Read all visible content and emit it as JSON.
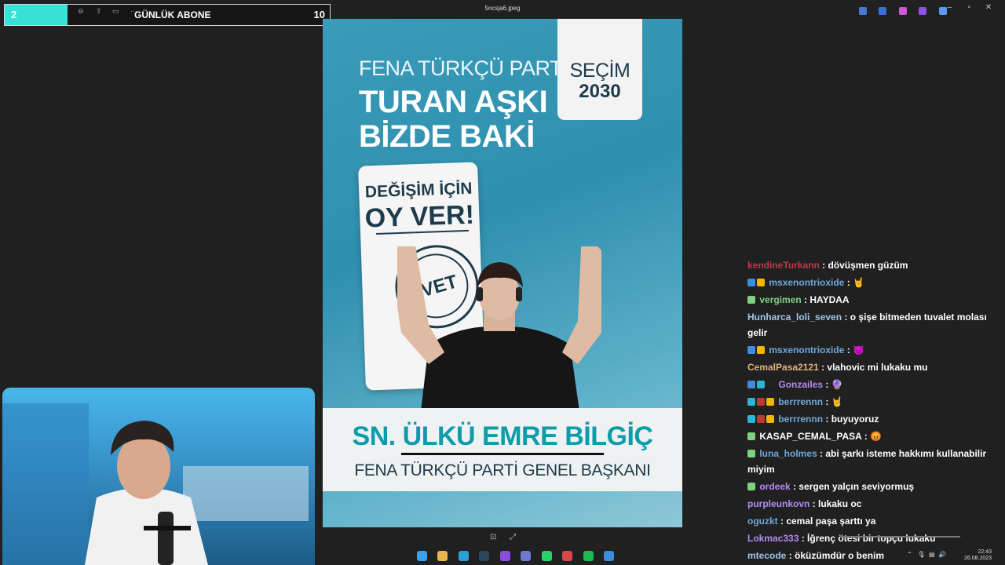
{
  "goal": {
    "current": "2",
    "label": "GÜNLÜK ABONE",
    "target": "10",
    "progress": 0.2
  },
  "viewer": {
    "filename": "5ncsja6.jpeg"
  },
  "window_controls": {
    "minimize": "–",
    "maximize": "▫",
    "close": "✕"
  },
  "poster": {
    "party_line": "FENA TÜRKÇÜ PARTİ",
    "slogan_1": "TURAN AŞKI",
    "slogan_2": "BİZDE BAKİ",
    "secim_word": "SEÇİM",
    "secim_year": "2030",
    "ballot_line1": "DEĞİŞİM İÇİN",
    "ballot_line2": "OY VER!",
    "stamp": "EVET",
    "name": "SN. ÜLKÜ EMRE BİLGİÇ",
    "title": "FENA TÜRKÇÜ PARTİ GENEL BAŞKANI"
  },
  "chat": {
    "messages": [
      {
        "user": "kendineTurkann",
        "text": "dövüşmen güzüm",
        "color": "#c0394b",
        "badges": []
      },
      {
        "user": "msxenontrioxide",
        "text": "🤘",
        "color": "#6fa8dc",
        "badges": [
          "#3a8fd8",
          "#f2b600"
        ]
      },
      {
        "user": "vergimen",
        "text": "HAYDAA",
        "color": "#7fd07f",
        "badges": [
          "#7fd07f"
        ]
      },
      {
        "user": "Hunharca_loli_seven",
        "text": "o şişe bitmeden tuvalet molası",
        "text2": "gelir",
        "color": "#9fc5e8",
        "badges": []
      },
      {
        "user": "msxenontrioxide",
        "text": "😈",
        "color": "#6fa8dc",
        "badges": [
          "#3a8fd8",
          "#f2b600"
        ]
      },
      {
        "user": "CemalPasa2121",
        "text": "vlahovic mi lukaku mu",
        "color": "#e0b080",
        "badges": []
      },
      {
        "user": "Gonzailes",
        "text": "🔮",
        "color": "#b58bf5",
        "badges": [
          "#3a8fd8",
          "#2fb4d8",
          "#222222"
        ]
      },
      {
        "user": "berrrennn",
        "text": "🤘",
        "color": "#6fa8dc",
        "badges": [
          "#2fb4d8",
          "#c0392b",
          "#f2b600"
        ]
      },
      {
        "user": "berrrennn",
        "text": "buyuyoruz",
        "color": "#6fa8dc",
        "badges": [
          "#2fb4d8",
          "#c0392b",
          "#f2b600"
        ]
      },
      {
        "user": "KASAP_CEMAL_PASA",
        "text": "😡",
        "color": "#ffffff",
        "badges": [
          "#7fd07f"
        ]
      },
      {
        "user": "luna_holmes",
        "text": "abi şarkı isteme hakkımı kullanabilir",
        "text2": "miyim",
        "color": "#6fa8dc",
        "badges": [
          "#7fd07f"
        ]
      },
      {
        "user": "ordeek",
        "text": "sergen yalçın seviyormuş",
        "color": "#b58bf5",
        "badges": [
          "#7fd07f"
        ]
      },
      {
        "user": "purpleunkovn",
        "text": "lukaku oc",
        "color": "#b58bf5",
        "badges": []
      },
      {
        "user": "oguzkt",
        "text": "cemal paşa şarttı ya",
        "color": "#6fa8dc",
        "badges": []
      },
      {
        "user": "Lokmac333",
        "text": "İğrenç ötesi bir topçu lukaku",
        "color": "#b58bf5",
        "badges": []
      },
      {
        "user": "mtecode",
        "text": "öküzümdür o benim",
        "color": "#9fc5e8",
        "badges": []
      }
    ]
  },
  "clock": {
    "time": "22:43",
    "date": "26.08.2023"
  },
  "colors": {
    "goal_fill": "#37e1d6",
    "poster_blue": "#3a9cb9",
    "name_teal": "#0e9baa"
  }
}
